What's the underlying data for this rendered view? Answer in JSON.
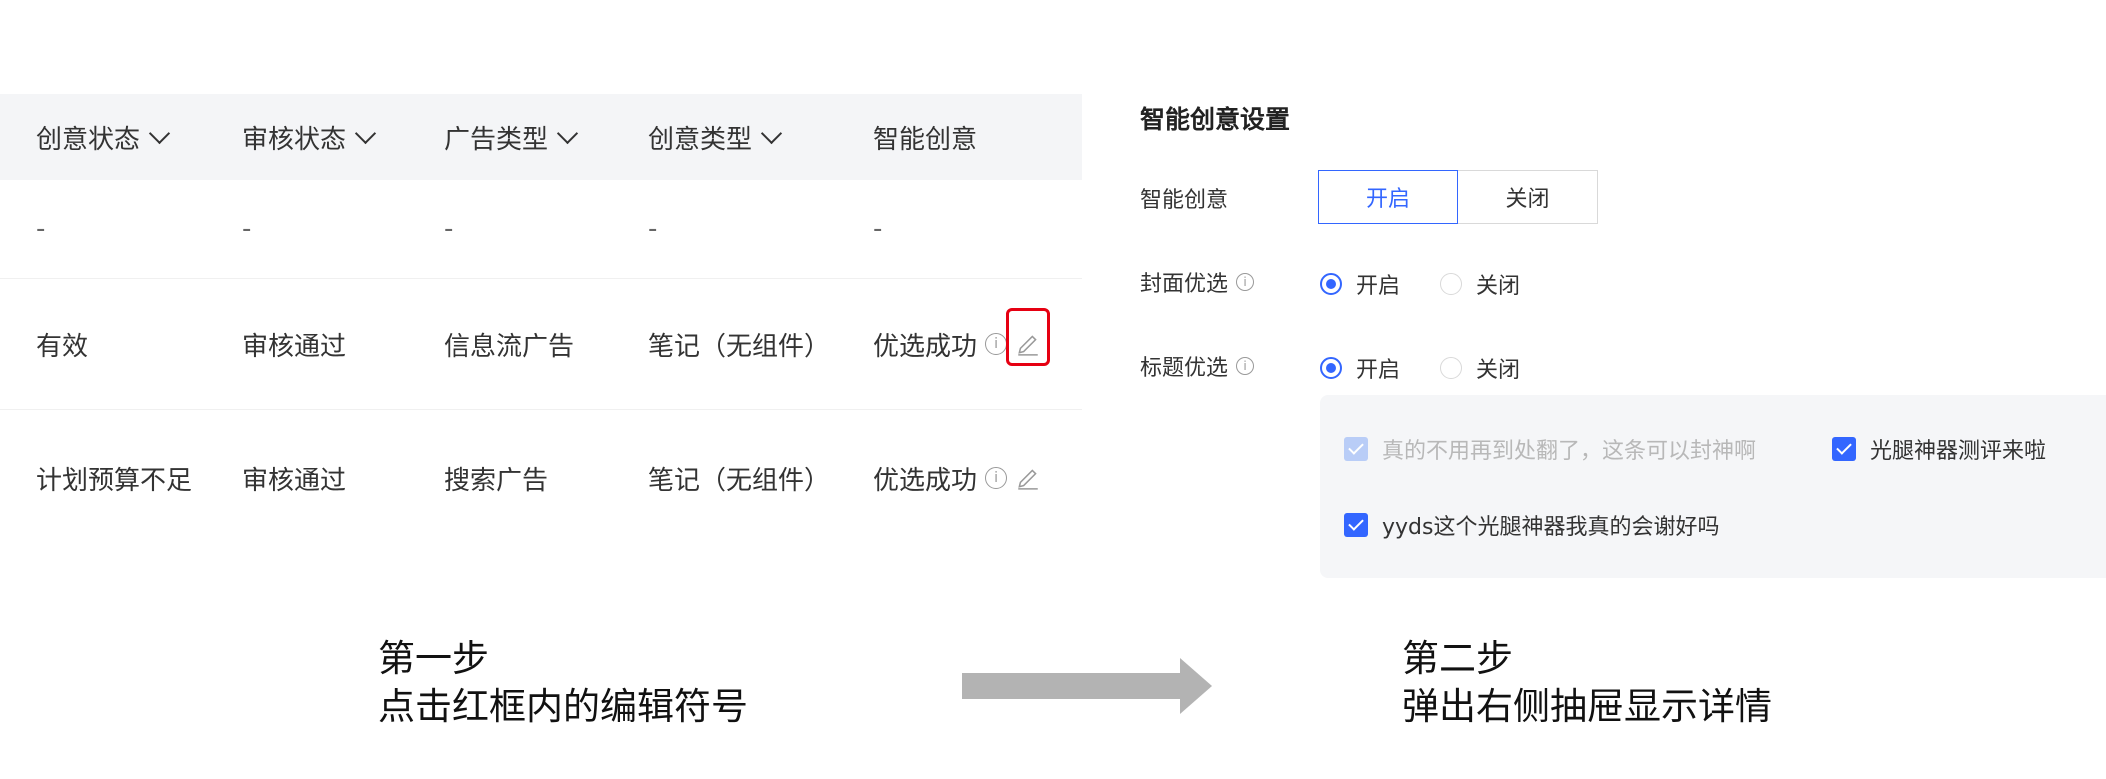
{
  "table": {
    "headers": [
      "创意状态",
      "审核状态",
      "广告类型",
      "创意类型",
      "智能创意"
    ],
    "rows": [
      [
        "-",
        "-",
        "-",
        "-",
        "-"
      ],
      [
        "有效",
        "审核通过",
        "信息流广告",
        "笔记（无组件）",
        "优选成功"
      ],
      [
        "计划预算不足",
        "审核通过",
        "搜索广告",
        "笔记（无组件）",
        "优选成功"
      ]
    ]
  },
  "panel": {
    "title": "智能创意设置",
    "smart_label": "智能创意",
    "smart_on": "开启",
    "smart_off": "关闭",
    "cover_label": "封面优选",
    "title_label": "标题优选",
    "on": "开启",
    "off": "关闭",
    "titles": [
      {
        "text": "真的不用再到处翻了，这条可以封神啊",
        "checked": true,
        "disabled": true
      },
      {
        "text": "光腿神器测评来啦",
        "checked": true,
        "disabled": false
      },
      {
        "text": "yyds这个光腿神器我真的会谢好吗",
        "checked": true,
        "disabled": false
      }
    ]
  },
  "captions": {
    "step1_title": "第一步",
    "step1_desc": "点击红框内的编辑符号",
    "step2_title": "第二步",
    "step2_desc": "弹出右侧抽屉显示详情"
  },
  "colors": {
    "accent": "#3366ff",
    "highlight": "#e60012",
    "arrow": "#b3b3b3"
  }
}
